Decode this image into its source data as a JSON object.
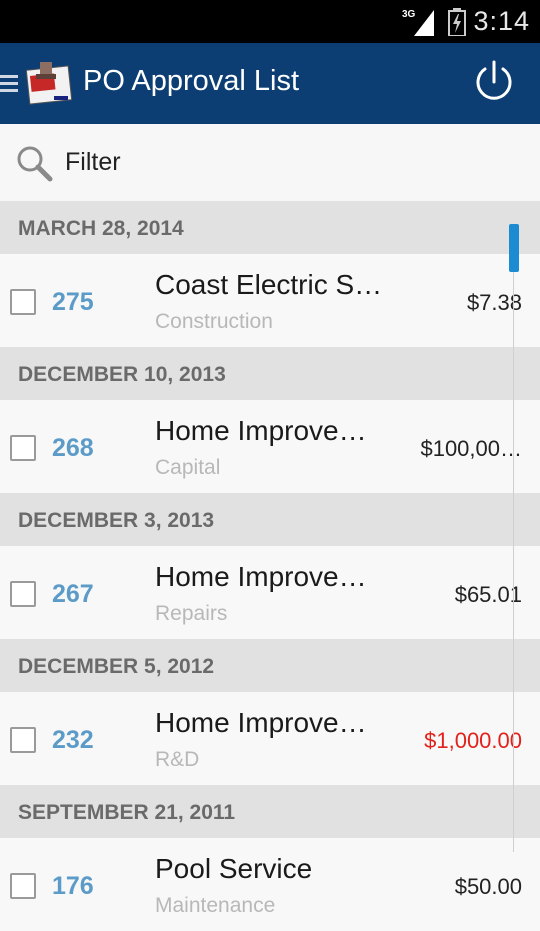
{
  "status_bar": {
    "time": "3:14",
    "network": "3G"
  },
  "app_bar": {
    "title": "PO Approval List"
  },
  "filter": {
    "placeholder": "Filter"
  },
  "sections": [
    {
      "date": "MARCH 28, 2014",
      "items": [
        {
          "number": "275",
          "vendor": "Coast Electric S…",
          "category": "Construction",
          "amount": "$7.38",
          "amount_color": "#222222"
        }
      ]
    },
    {
      "date": "DECEMBER 10, 2013",
      "items": [
        {
          "number": "268",
          "vendor": "Home Improve…",
          "category": "Capital",
          "amount": "$100,00…",
          "amount_color": "#222222"
        }
      ]
    },
    {
      "date": "DECEMBER 3, 2013",
      "items": [
        {
          "number": "267",
          "vendor": "Home Improve…",
          "category": "Repairs",
          "amount": "$65.01",
          "amount_color": "#222222"
        }
      ]
    },
    {
      "date": "DECEMBER 5, 2012",
      "items": [
        {
          "number": "232",
          "vendor": "Home Improve…",
          "category": "R&D",
          "amount": "$1,000.00",
          "amount_color": "#e2221a"
        }
      ]
    },
    {
      "date": "SEPTEMBER 21, 2011",
      "items": [
        {
          "number": "176",
          "vendor": "Pool Service",
          "category": "Maintenance",
          "amount": "$50.00",
          "amount_color": "#222222"
        }
      ]
    }
  ],
  "colors": {
    "app_bar": "#0d3e73",
    "po_number": "#5c9bc8",
    "negative_amount": "#e2221a",
    "scroll_thumb": "#1c8bd1"
  },
  "icons": {
    "menu": "menu-icon",
    "logo": "app-logo-icon",
    "power": "power-icon",
    "search": "search-icon"
  }
}
